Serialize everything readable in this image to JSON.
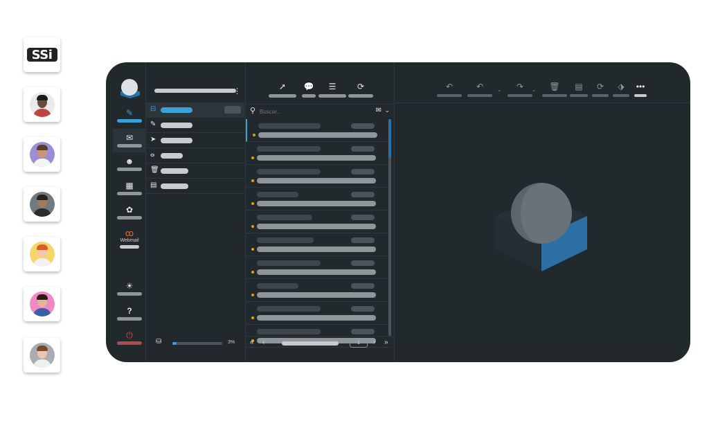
{
  "sidebar_tiles": [
    {
      "kind": "logo",
      "text": "SSi"
    },
    {
      "kind": "avatar",
      "name": "avatar-1",
      "bg": "#e9eaec",
      "skin": "#6b4a37",
      "shirt": "#c0453d",
      "hair": "#1e1a18"
    },
    {
      "kind": "avatar",
      "name": "avatar-2",
      "bg": "#9a8fd6",
      "skin": "#c99575",
      "shirt": "#f4f4f4",
      "hair": "#5a3d2b"
    },
    {
      "kind": "avatar",
      "name": "avatar-3",
      "bg": "#6e7a80",
      "skin": "#a6795b",
      "shirt": "#2a2d2f",
      "hair": "#2c211a"
    },
    {
      "kind": "avatar",
      "name": "avatar-4",
      "bg": "#f6d66a",
      "skin": "#f3c7ad",
      "shirt": "#f2f2f2",
      "hair": "#d95b2e"
    },
    {
      "kind": "avatar",
      "name": "avatar-5",
      "bg": "#ef88c4",
      "skin": "#e5b59b",
      "shirt": "#3b5fa8",
      "hair": "#2a1b16"
    },
    {
      "kind": "avatar",
      "name": "avatar-6",
      "bg": "#a9adb2",
      "skin": "#ebc5ad",
      "shirt": "#efefef",
      "hair": "#7a4a2d"
    }
  ],
  "nav": {
    "webmail_label": "Webmail",
    "items": [
      {
        "name": "compose",
        "icon": "✎"
      },
      {
        "name": "mail",
        "icon": "✉"
      },
      {
        "name": "contacts",
        "icon": "☻"
      },
      {
        "name": "calendar",
        "icon": "▦"
      },
      {
        "name": "settings",
        "icon": "✿"
      },
      {
        "name": "webmail",
        "icon": "ꝏ"
      },
      {
        "name": "theme",
        "icon": "☀"
      },
      {
        "name": "help",
        "icon": "?"
      },
      {
        "name": "logout",
        "icon": "⏻"
      }
    ]
  },
  "folders": [
    "inbox",
    "drafts",
    "sent",
    "junk",
    "trash",
    "archive"
  ],
  "search": {
    "placeholder": "Buscar..."
  },
  "quota": {
    "percent_label": "3%",
    "percent": 0.08
  },
  "pager": {
    "page": "1"
  },
  "colors": {
    "accent": "#3aa2d6",
    "unread_dot": "#e2a100",
    "logout": "#b24a4a",
    "brand_box": "#2c6fa3"
  }
}
